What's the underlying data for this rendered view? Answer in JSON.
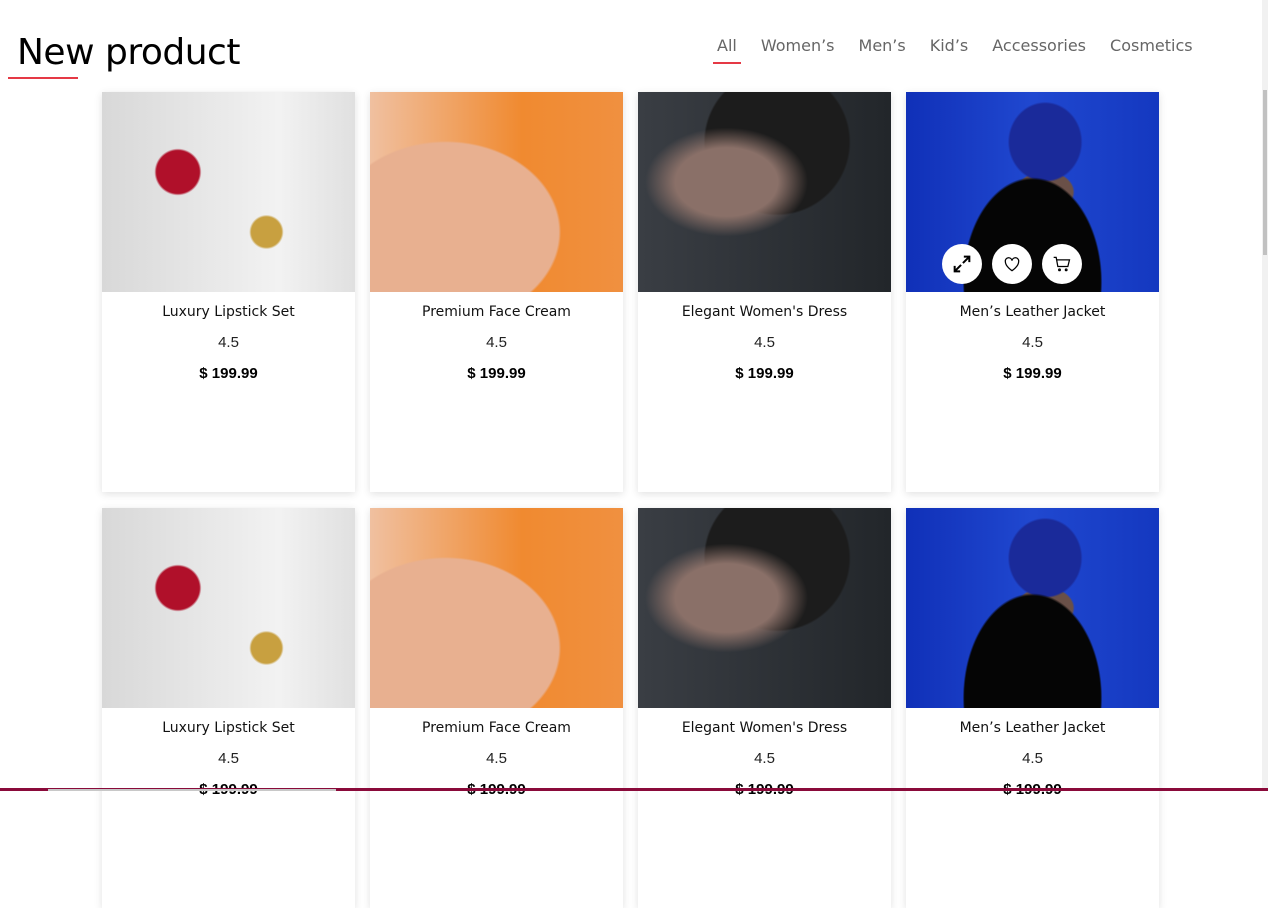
{
  "header": {
    "title": "New product"
  },
  "tabs": [
    {
      "label": "All",
      "active": true
    },
    {
      "label": "Women’s"
    },
    {
      "label": "Men’s"
    },
    {
      "label": "Kid’s"
    },
    {
      "label": "Accessories"
    },
    {
      "label": "Cosmetics"
    }
  ],
  "accent_color": "#e53945",
  "products": [
    {
      "name": "Luxury Lipstick Set",
      "rating": "4.5",
      "price": "$ 199.99",
      "image": "lip"
    },
    {
      "name": "Premium Face Cream",
      "rating": "4.5",
      "price": "$ 199.99",
      "image": "cream"
    },
    {
      "name": "Elegant Women's Dress",
      "rating": "4.5",
      "price": "$ 199.99",
      "image": "woman"
    },
    {
      "name": "Men’s Leather Jacket",
      "rating": "4.5",
      "price": "$ 199.99",
      "image": "man",
      "hovered": true
    },
    {
      "name": "Luxury Lipstick Set",
      "rating": "4.5",
      "price": "$ 199.99",
      "image": "lip"
    },
    {
      "name": "Premium Face Cream",
      "rating": "4.5",
      "price": "$ 199.99",
      "image": "cream"
    },
    {
      "name": "Elegant Women's Dress",
      "rating": "4.5",
      "price": "$ 199.99",
      "image": "woman"
    },
    {
      "name": "Men’s Leather Jacket",
      "rating": "4.5",
      "price": "$ 199.99",
      "image": "man"
    }
  ],
  "card_actions": [
    "expand-icon",
    "heart-icon",
    "cart-icon"
  ]
}
